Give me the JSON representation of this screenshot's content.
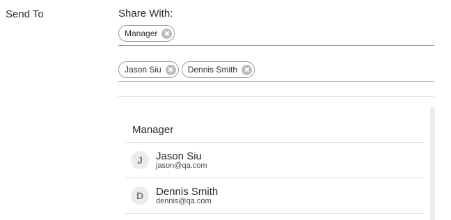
{
  "send_to": {
    "label": "Send To"
  },
  "share_with": {
    "label": "Share With:",
    "groups_chips": [
      {
        "label": "Manager",
        "icon": "close-icon"
      }
    ],
    "people_chips": [
      {
        "label": "Jason Siu",
        "icon": "close-icon"
      },
      {
        "label": "Dennis Smith",
        "icon": "close-icon"
      }
    ]
  },
  "dropdown": {
    "header": "Manager",
    "people": [
      {
        "initial": "J",
        "name": "Jason Siu",
        "email": "jason@qa.com"
      },
      {
        "initial": "D",
        "name": "Dennis Smith",
        "email": "dennis@qa.com"
      }
    ]
  },
  "colors": {
    "text": "#2b2b2b",
    "chip_border": "#9a9a9a",
    "remove_icon": "#bdbdbd",
    "avatar_bg": "#ececec"
  }
}
